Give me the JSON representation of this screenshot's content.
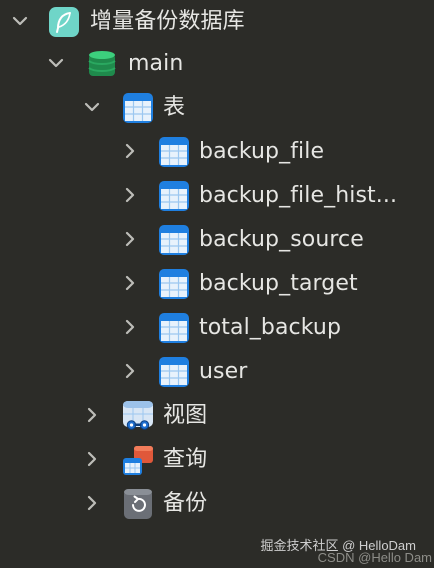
{
  "tree": {
    "root": {
      "label": "增量备份数据库",
      "icon": "feather-app-icon",
      "expanded": true
    },
    "schema": {
      "label": "main",
      "icon": "database-icon",
      "expanded": true
    },
    "tables_group": {
      "label": "表",
      "icon": "table-group-icon",
      "expanded": true
    },
    "tables": [
      {
        "label": "backup_file",
        "icon": "table-icon"
      },
      {
        "label": "backup_file_hist...",
        "icon": "table-icon"
      },
      {
        "label": "backup_source",
        "icon": "table-icon"
      },
      {
        "label": "backup_target",
        "icon": "table-icon"
      },
      {
        "label": "total_backup",
        "icon": "table-icon"
      },
      {
        "label": "user",
        "icon": "table-icon"
      }
    ],
    "views_group": {
      "label": "视图",
      "icon": "view-icon",
      "expanded": false
    },
    "queries_group": {
      "label": "查询",
      "icon": "query-icon",
      "expanded": false
    },
    "backups_group": {
      "label": "备份",
      "icon": "backup-icon",
      "expanded": false
    }
  },
  "watermark": {
    "text": "掘金技术社区 @ HelloDam",
    "back_text": "CSDN @Hello Dam"
  },
  "colors": {
    "background": "#2c2c28",
    "text": "#e6e6e3",
    "chevron": "#bdbdb8",
    "table_blue": "#1f7fe0",
    "db_green": "#2aa860",
    "app_teal": "#6fd5c8"
  }
}
